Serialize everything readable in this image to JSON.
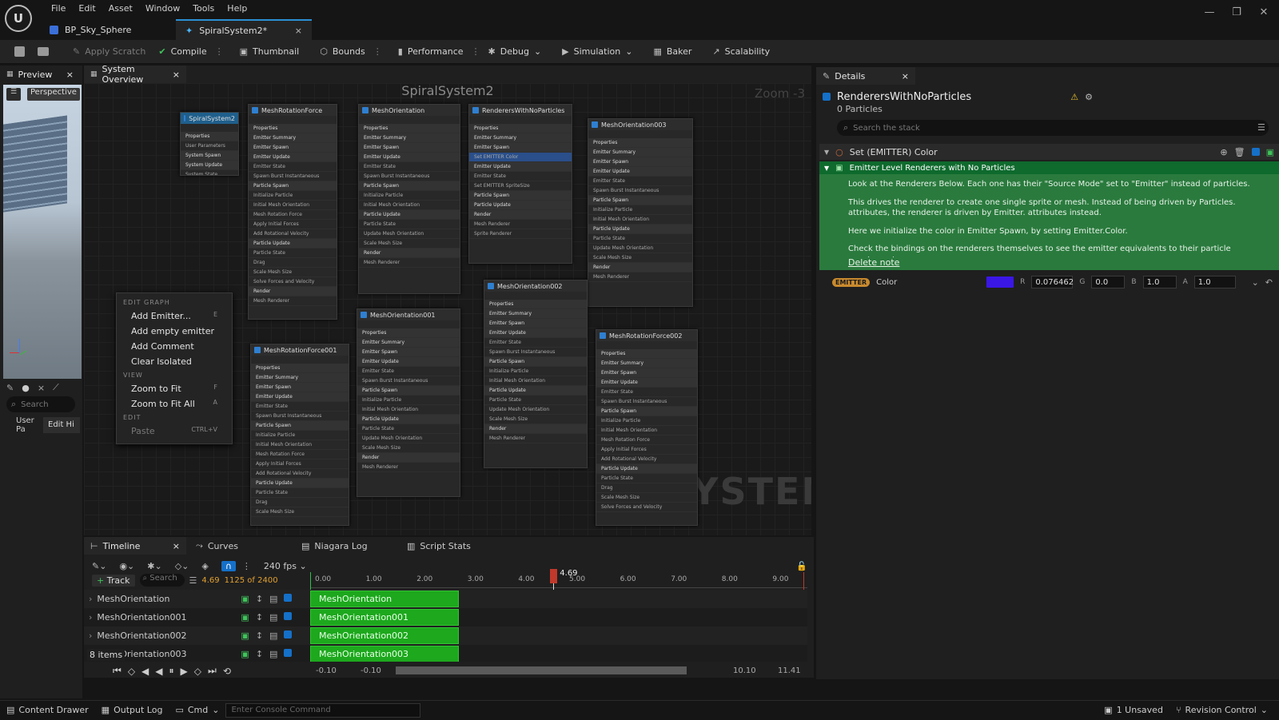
{
  "window": {
    "logo": "U",
    "menu": [
      "File",
      "Edit",
      "Asset",
      "Window",
      "Tools",
      "Help"
    ],
    "tabs": [
      {
        "label": "BP_Sky_Sphere",
        "icon": "blueprint-icon"
      },
      {
        "label": "SpiralSystem2*",
        "icon": "niagara-system-icon"
      }
    ],
    "controls": {
      "minimize": "—",
      "restore": "❐",
      "close": "✕"
    }
  },
  "toolbar": {
    "apply_scratch": "Apply Scratch",
    "compile": "Compile",
    "thumbnail": "Thumbnail",
    "bounds": "Bounds",
    "performance": "Performance",
    "debug": "Debug",
    "simulation": "Simulation",
    "baker": "Baker",
    "scalability": "Scalability"
  },
  "left_panel": {
    "preview_tab": "Preview",
    "viewport_mode": "Perspective",
    "search_placeholder": "Search",
    "tabs": [
      "User Pa",
      "Edit Hi"
    ]
  },
  "graph": {
    "tab": "System Overview",
    "title": "SpiralSystem2",
    "zoom": "Zoom -3",
    "watermark": "SYSTEM",
    "nodes": [
      {
        "title": "SpiralSystem2",
        "rows": [
          "Properties",
          "User Parameters",
          "System Spawn",
          "System Update",
          "System State"
        ]
      },
      {
        "title": "MeshRotationForce",
        "rows": [
          "Properties",
          "Emitter Summary",
          "Emitter Spawn",
          "Emitter Update",
          "Emitter State",
          "Spawn Burst Instantaneous",
          "Particle Spawn",
          "Initialize Particle",
          "Initial Mesh Orientation",
          "Mesh Rotation Force",
          "Apply Initial Forces",
          "Add Rotational Velocity",
          "Particle Update",
          "Particle State",
          "Drag",
          "Scale Mesh Size",
          "Solve Forces and Velocity",
          "Render",
          "Mesh Renderer"
        ]
      },
      {
        "title": "MeshOrientation",
        "rows": [
          "Properties",
          "Emitter Summary",
          "Emitter Spawn",
          "Emitter Update",
          "Emitter State",
          "Spawn Burst Instantaneous",
          "Particle Spawn",
          "Initialize Particle",
          "Initial Mesh Orientation",
          "Particle Update",
          "Particle State",
          "Update Mesh Orientation",
          "Scale Mesh Size",
          "Render",
          "Mesh Renderer"
        ]
      },
      {
        "title": "RenderersWithNoParticles",
        "rows": [
          "Properties",
          "Emitter Summary",
          "Emitter Spawn",
          "Set EMITTER Color",
          "Emitter Update",
          "Emitter State",
          "Set EMITTER SpriteSize",
          "Particle Spawn",
          "Particle Update",
          "Render",
          "Mesh Renderer",
          "Sprite Renderer"
        ]
      },
      {
        "title": "MeshOrientation003",
        "rows": [
          "Properties",
          "Emitter Summary",
          "Emitter Spawn",
          "Emitter Update",
          "Emitter State",
          "Spawn Burst Instantaneous",
          "Particle Spawn",
          "Initialize Particle",
          "Initial Mesh Orientation",
          "Particle Update",
          "Particle State",
          "Update Mesh Orientation",
          "Scale Mesh Size",
          "Render",
          "Mesh Renderer"
        ]
      },
      {
        "title": "MeshRotationForce001",
        "rows": [
          "Properties",
          "Emitter Summary",
          "Emitter Spawn",
          "Emitter Update",
          "Emitter State",
          "Spawn Burst Instantaneous",
          "Particle Spawn",
          "Initialize Particle",
          "Initial Mesh Orientation",
          "Mesh Rotation Force",
          "Apply Initial Forces",
          "Add Rotational Velocity",
          "Particle Update",
          "Particle State",
          "Drag",
          "Scale Mesh Size"
        ]
      },
      {
        "title": "MeshOrientation001",
        "rows": [
          "Properties",
          "Emitter Summary",
          "Emitter Spawn",
          "Emitter Update",
          "Emitter State",
          "Spawn Burst Instantaneous",
          "Particle Spawn",
          "Initialize Particle",
          "Initial Mesh Orientation",
          "Particle Update",
          "Particle State",
          "Update Mesh Orientation",
          "Scale Mesh Size",
          "Render",
          "Mesh Renderer"
        ]
      },
      {
        "title": "MeshOrientation002",
        "rows": [
          "Properties",
          "Emitter Summary",
          "Emitter Spawn",
          "Emitter Update",
          "Emitter State",
          "Spawn Burst Instantaneous",
          "Particle Spawn",
          "Initialize Particle",
          "Initial Mesh Orientation",
          "Particle Update",
          "Particle State",
          "Update Mesh Orientation",
          "Scale Mesh Size",
          "Render",
          "Mesh Renderer"
        ]
      },
      {
        "title": "MeshRotationForce002",
        "rows": [
          "Properties",
          "Emitter Summary",
          "Emitter Spawn",
          "Emitter Update",
          "Emitter State",
          "Spawn Burst Instantaneous",
          "Particle Spawn",
          "Initialize Particle",
          "Initial Mesh Orientation",
          "Mesh Rotation Force",
          "Apply Initial Forces",
          "Add Rotational Velocity",
          "Particle Update",
          "Particle State",
          "Drag",
          "Scale Mesh Size",
          "Solve Forces and Velocity"
        ]
      }
    ]
  },
  "context_menu": {
    "edit_graph": "EDIT GRAPH",
    "add_emitter": "Add Emitter...",
    "add_emitter_key": "E",
    "add_empty": "Add empty emitter",
    "add_comment": "Add Comment",
    "clear_isolated": "Clear Isolated",
    "view": "VIEW",
    "zoom_fit": "Zoom to Fit",
    "zoom_fit_key": "F",
    "zoom_fit_all": "Zoom to Fit All",
    "zoom_fit_all_key": "A",
    "edit": "EDIT",
    "paste": "Paste",
    "paste_key": "CTRL+V"
  },
  "details": {
    "tab": "Details",
    "title": "RenderersWithNoParticles",
    "particles": "0 Particles",
    "search_placeholder": "Search the stack",
    "section": "Set (EMITTER) Color",
    "note_title": "Emitter Level Renderers with No Particles",
    "note_lines": [
      "Look at the Renderers Below. Each one has their \"Source Mode\" set to \"Emitter\" instead of particles.",
      "This drives the renderer to create one single sprite or mesh. Instead of being driven by Particles. attributes, the renderer is driven by Emitter. attributes instead.",
      "Here we initialize the color in Emitter Spawn, by setting Emitter.Color.",
      "Check the bindings on the renderers themselves to see the emitter equivalents to their particle counterparts."
    ],
    "delete_note": "Delete note",
    "param_badge": "EMITTER",
    "param_name": "Color",
    "swatch_color": "#3b17e6",
    "r_label": "R",
    "r": "0.076462",
    "g_label": "G",
    "g": "0.0",
    "b_label": "B",
    "b": "1.0",
    "a_label": "A",
    "a": "1.0"
  },
  "timeline": {
    "tabs": [
      "Timeline",
      "Curves",
      "Niagara Log",
      "Script Stats"
    ],
    "fps": "240 fps",
    "add_track": "Track",
    "search_placeholder": "Search",
    "current_time": "4.69",
    "frame": "1125 of 2400",
    "ticks": [
      "0.00",
      "1.00",
      "2.00",
      "3.00",
      "4.00",
      "5.00",
      "6.00",
      "7.00",
      "8.00",
      "9.00"
    ],
    "playhead": "4.69",
    "tracks": [
      "MeshOrientation",
      "MeshOrientation001",
      "MeshOrientation002",
      "MeshOrientation003"
    ],
    "item_count": "8 items",
    "range_start_a": "-0.10",
    "range_start_b": "-0.10",
    "range_end_a": "10.10",
    "range_end_b": "11.41"
  },
  "statusbar": {
    "content_drawer": "Content Drawer",
    "output_log": "Output Log",
    "cmd": "Cmd",
    "console_placeholder": "Enter Console Command",
    "unsaved": "1 Unsaved",
    "revision": "Revision Control"
  }
}
